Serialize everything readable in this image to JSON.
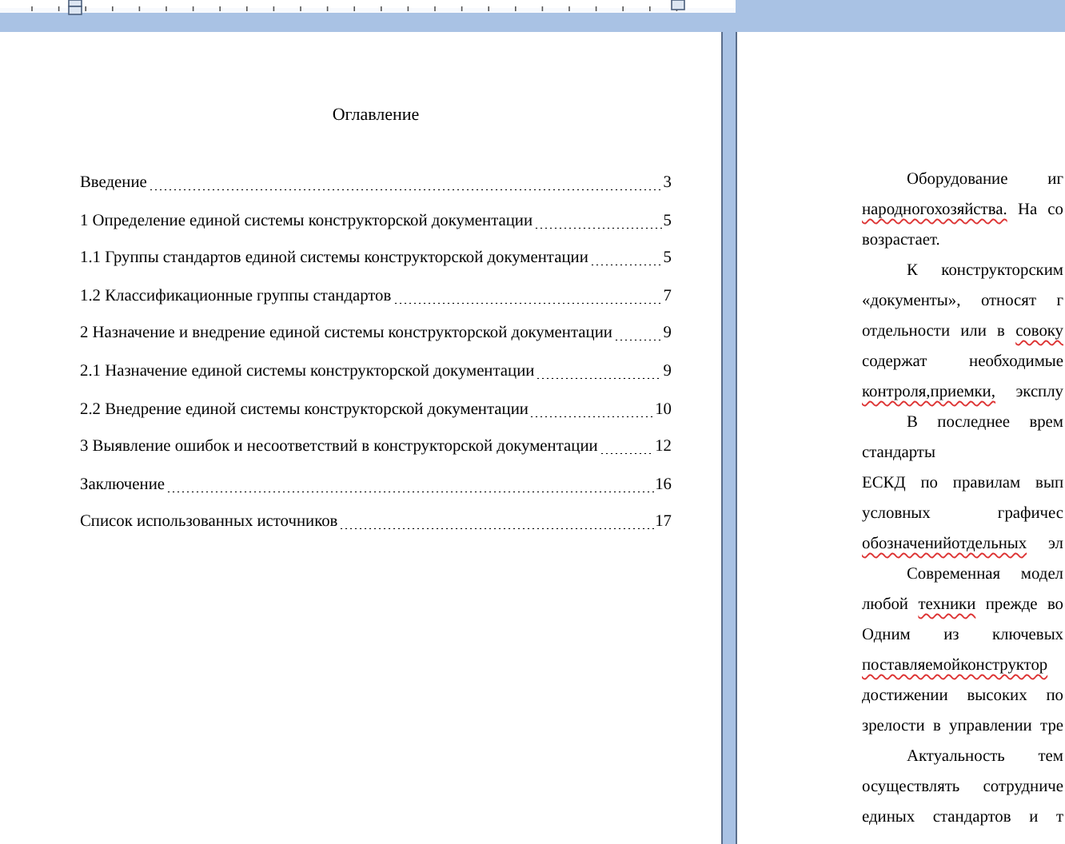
{
  "left_page": {
    "title": "Оглавление",
    "toc": [
      {
        "label": "Введение",
        "page": "3"
      },
      {
        "label": "1 Определение единой системы конструкторской документации",
        "page": "5"
      },
      {
        "label": "1.1 Группы стандартов единой системы конструкторской документации",
        "page": "5"
      },
      {
        "label": "1.2 Классификационные группы стандартов",
        "page": "7"
      },
      {
        "label": "2 Назначение и внедрение единой системы конструкторской документации",
        "page": "9"
      },
      {
        "label": "2.1 Назначение единой системы конструкторской документации",
        "page": "9"
      },
      {
        "label": "2.2 Внедрение единой системы конструкторской документации",
        "page": "10"
      },
      {
        "label": "3 Выявление ошибок и несоответствий в конструкторской документации",
        "page": "12"
      },
      {
        "label": "Заключение",
        "page": "16"
      },
      {
        "label": "Список использованных источников",
        "page": "17"
      }
    ]
  },
  "right_page": {
    "lines": [
      {
        "kind": "first",
        "segments": [
          {
            "text": "Оборудование иг",
            "flagged": false
          }
        ]
      },
      {
        "kind": "justify",
        "segments": [
          {
            "text": "народногохозяйства.",
            "flagged": true
          },
          {
            "text": " На со",
            "flagged": false
          }
        ]
      },
      {
        "kind": "last",
        "segments": [
          {
            "text": "возрастает.",
            "flagged": false
          }
        ]
      },
      {
        "kind": "first",
        "segments": [
          {
            "text": "К конструкторским",
            "flagged": false
          }
        ]
      },
      {
        "kind": "justify",
        "segments": [
          {
            "text": "«документы», относят г",
            "flagged": false
          }
        ]
      },
      {
        "kind": "justify",
        "segments": [
          {
            "text": "отдельности или в ",
            "flagged": false
          },
          {
            "text": "совоку",
            "flagged": true
          }
        ]
      },
      {
        "kind": "justify",
        "segments": [
          {
            "text": "содержат необходимые",
            "flagged": false
          }
        ]
      },
      {
        "kind": "justify",
        "segments": [
          {
            "text": "контроля,приемки,",
            "flagged": true
          },
          {
            "text": " эксплу",
            "flagged": false
          }
        ]
      },
      {
        "kind": "first",
        "segments": [
          {
            "text": "В последнее врем",
            "flagged": false
          }
        ]
      },
      {
        "kind": "last",
        "segments": [
          {
            "text": "стандарты",
            "flagged": false
          }
        ]
      },
      {
        "kind": "justify",
        "segments": [
          {
            "text": "ЕСКД по правилам вып",
            "flagged": false
          }
        ]
      },
      {
        "kind": "justify",
        "segments": [
          {
            "text": "условных графичес",
            "flagged": false
          }
        ]
      },
      {
        "kind": "justify",
        "segments": [
          {
            "text": "обозначенийотдельных",
            "flagged": true
          },
          {
            "text": " эл",
            "flagged": false
          }
        ]
      },
      {
        "kind": "first",
        "segments": [
          {
            "text": "Современная модел",
            "flagged": false
          }
        ]
      },
      {
        "kind": "justify",
        "segments": [
          {
            "text": "любой ",
            "flagged": false
          },
          {
            "text": "техники",
            "flagged": true
          },
          {
            "text": " прежде во",
            "flagged": false
          }
        ]
      },
      {
        "kind": "justify",
        "segments": [
          {
            "text": "Одним из ключевых",
            "flagged": false
          }
        ]
      },
      {
        "kind": "justify",
        "segments": [
          {
            "text": "поставляемойконструктор",
            "flagged": true
          }
        ]
      },
      {
        "kind": "justify",
        "segments": [
          {
            "text": "достижении высоких по",
            "flagged": false
          }
        ]
      },
      {
        "kind": "justify",
        "segments": [
          {
            "text": "зрелости в управлении тре",
            "flagged": false
          }
        ]
      },
      {
        "kind": "first",
        "segments": [
          {
            "text": "Актуальность тем",
            "flagged": false
          }
        ]
      },
      {
        "kind": "justify",
        "segments": [
          {
            "text": "осуществлять сотрудниче",
            "flagged": false
          }
        ]
      },
      {
        "kind": "justify",
        "segments": [
          {
            "text": "единых стандартов и т",
            "flagged": false
          }
        ]
      }
    ]
  }
}
